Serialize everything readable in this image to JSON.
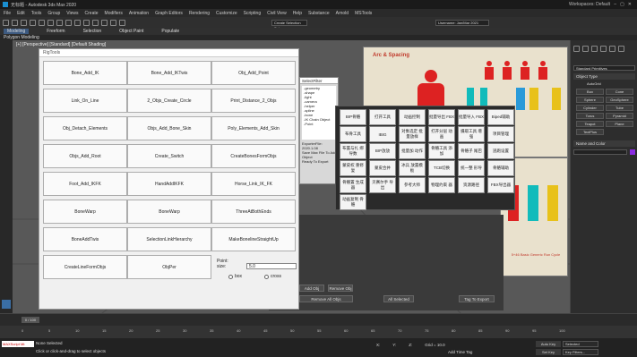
{
  "window": {
    "title": "无标题 - Autodesk 3ds Max 2020",
    "workspace": "Workspaces: Default"
  },
  "menu": [
    "File",
    "Edit",
    "Tools",
    "Group",
    "Views",
    "Create",
    "Modifiers",
    "Animation",
    "Graph Editors",
    "Rendering",
    "Customize",
    "Scripting",
    "Civil View",
    "Help",
    "Substance",
    "Arnold",
    "MSTools"
  ],
  "ribbon": {
    "tabs": [
      "Modeling",
      "Freeform",
      "Selection",
      "Object Paint",
      "Populate"
    ],
    "active": "Modeling",
    "sub": "Polygon Modeling"
  },
  "viewport": {
    "label": "[+] [Perspective] [Standard] [Default Shading]"
  },
  "toolbar": {
    "selection_set": "Create Selection Set",
    "user_field": "Username: Jan/Mar 2021"
  },
  "rigtools": {
    "title": "RigTools",
    "buttons": [
      [
        "Bone_Add_IK",
        "Bone_Add_IKTwis",
        "Obj_Add_Point"
      ],
      [
        "Link_On_Line",
        "2_Objs_Create_Circle",
        "Print_Distance_2_Objs"
      ],
      [
        "Obj_Detach_Elements",
        "Objs_Add_Bone_Skin",
        "Poly_Elements_Add_Skin"
      ],
      [
        "Objs_Add_Root",
        "Create_Switch",
        "CreateBonesFormObjs"
      ],
      [
        "Foot_Add_IKFK",
        "HandAddIKFK",
        "Horse_Link_IK_FK"
      ],
      [
        "BoneWarp",
        "BoneWarp",
        "ThreeAtBothEnds"
      ],
      [
        "BoneAddTwis",
        "SelectionLinkHierarchy",
        "MakeBonelineStraightUp"
      ],
      [
        "CreateLineFormObjs",
        "ObjPer"
      ]
    ],
    "point_label": "Point:",
    "size_label": "size:",
    "size_value": "5.0",
    "radio_box": "box",
    "radio_cross": "cross"
  },
  "cn_panel": {
    "rows": [
      [
        "BIP骨骼",
        "打开工具",
        "动画控制",
        "批量导出 FBX",
        "批量导入 FBX",
        "Biped辅助"
      ],
      [
        "布骨工具",
        "IBIG",
        "对象选定 批量放样",
        "打开分层 动画",
        "摄取工具 增强",
        "项目管理"
      ],
      [
        "布置与扎 绑导数",
        "BIP放放",
        "批量加 动作",
        "骨骼工具 添加",
        "骨骼子 尾巴",
        "逃跑设置"
      ],
      [
        "蒙皮权 重修复",
        "蒙皮合并",
        "冰兵 放置模板",
        "TCB切换",
        "统一整 形导",
        "骨骼辅助"
      ],
      [
        "骨骼置 生成器",
        "贝赛尔手 导出",
        "参考大师",
        "物理约束 器",
        "资源路径",
        "FBX导出器"
      ],
      [
        "动画复制 骨骼"
      ]
    ],
    "bottom_buttons": [
      "Add Obj",
      "Remove Obj",
      "Remove All Objs",
      "All Selected",
      "Tag To Export"
    ]
  },
  "reference": {
    "title": "Arc & Spacing",
    "label_a": "5+46 Basic Generic Run Cycle",
    "label_b": "Sequences"
  },
  "listpanel": {
    "title": "SelectFilter",
    "items": [
      "-geometry",
      "-shape",
      "-light",
      "-camera",
      "-helper",
      "-spline",
      "-bone",
      "-IK Chain Object",
      "-Point"
    ],
    "footer": [
      "ExporterFile: 2020.1.08",
      "Save Max File To Add Object",
      "Ready To Export"
    ]
  },
  "right_panel": {
    "head": "Standard Primitives",
    "object_type": "Object Type",
    "autogrid": "AutoGrid",
    "buttons": [
      "Box",
      "Cone",
      "Sphere",
      "GeoSphere",
      "Cylinder",
      "Tube",
      "Torus",
      "Pyramid",
      "Teapot",
      "Plane",
      "TextPlus"
    ],
    "name_color": "Name and Color"
  },
  "timeline": {
    "frame": "0 / 100",
    "ticks": [
      "0",
      "5",
      "10",
      "15",
      "20",
      "25",
      "30",
      "35",
      "40",
      "45",
      "50",
      "55",
      "60",
      "65",
      "70",
      "75",
      "80",
      "85",
      "90",
      "95",
      "100"
    ]
  },
  "status": {
    "selection": "None Selected",
    "hint": "Click or click-and-drag to select objects",
    "script_label": "MAXScript Mi:",
    "x": "X:",
    "y": "Y:",
    "z": "Z:",
    "grid": "Grid = 10.0",
    "add_tag": "Add Time Tag",
    "autokey": "Auto Key",
    "selected": "Selected",
    "setkey": "Set Key",
    "key_filters": "Key Filters..."
  }
}
